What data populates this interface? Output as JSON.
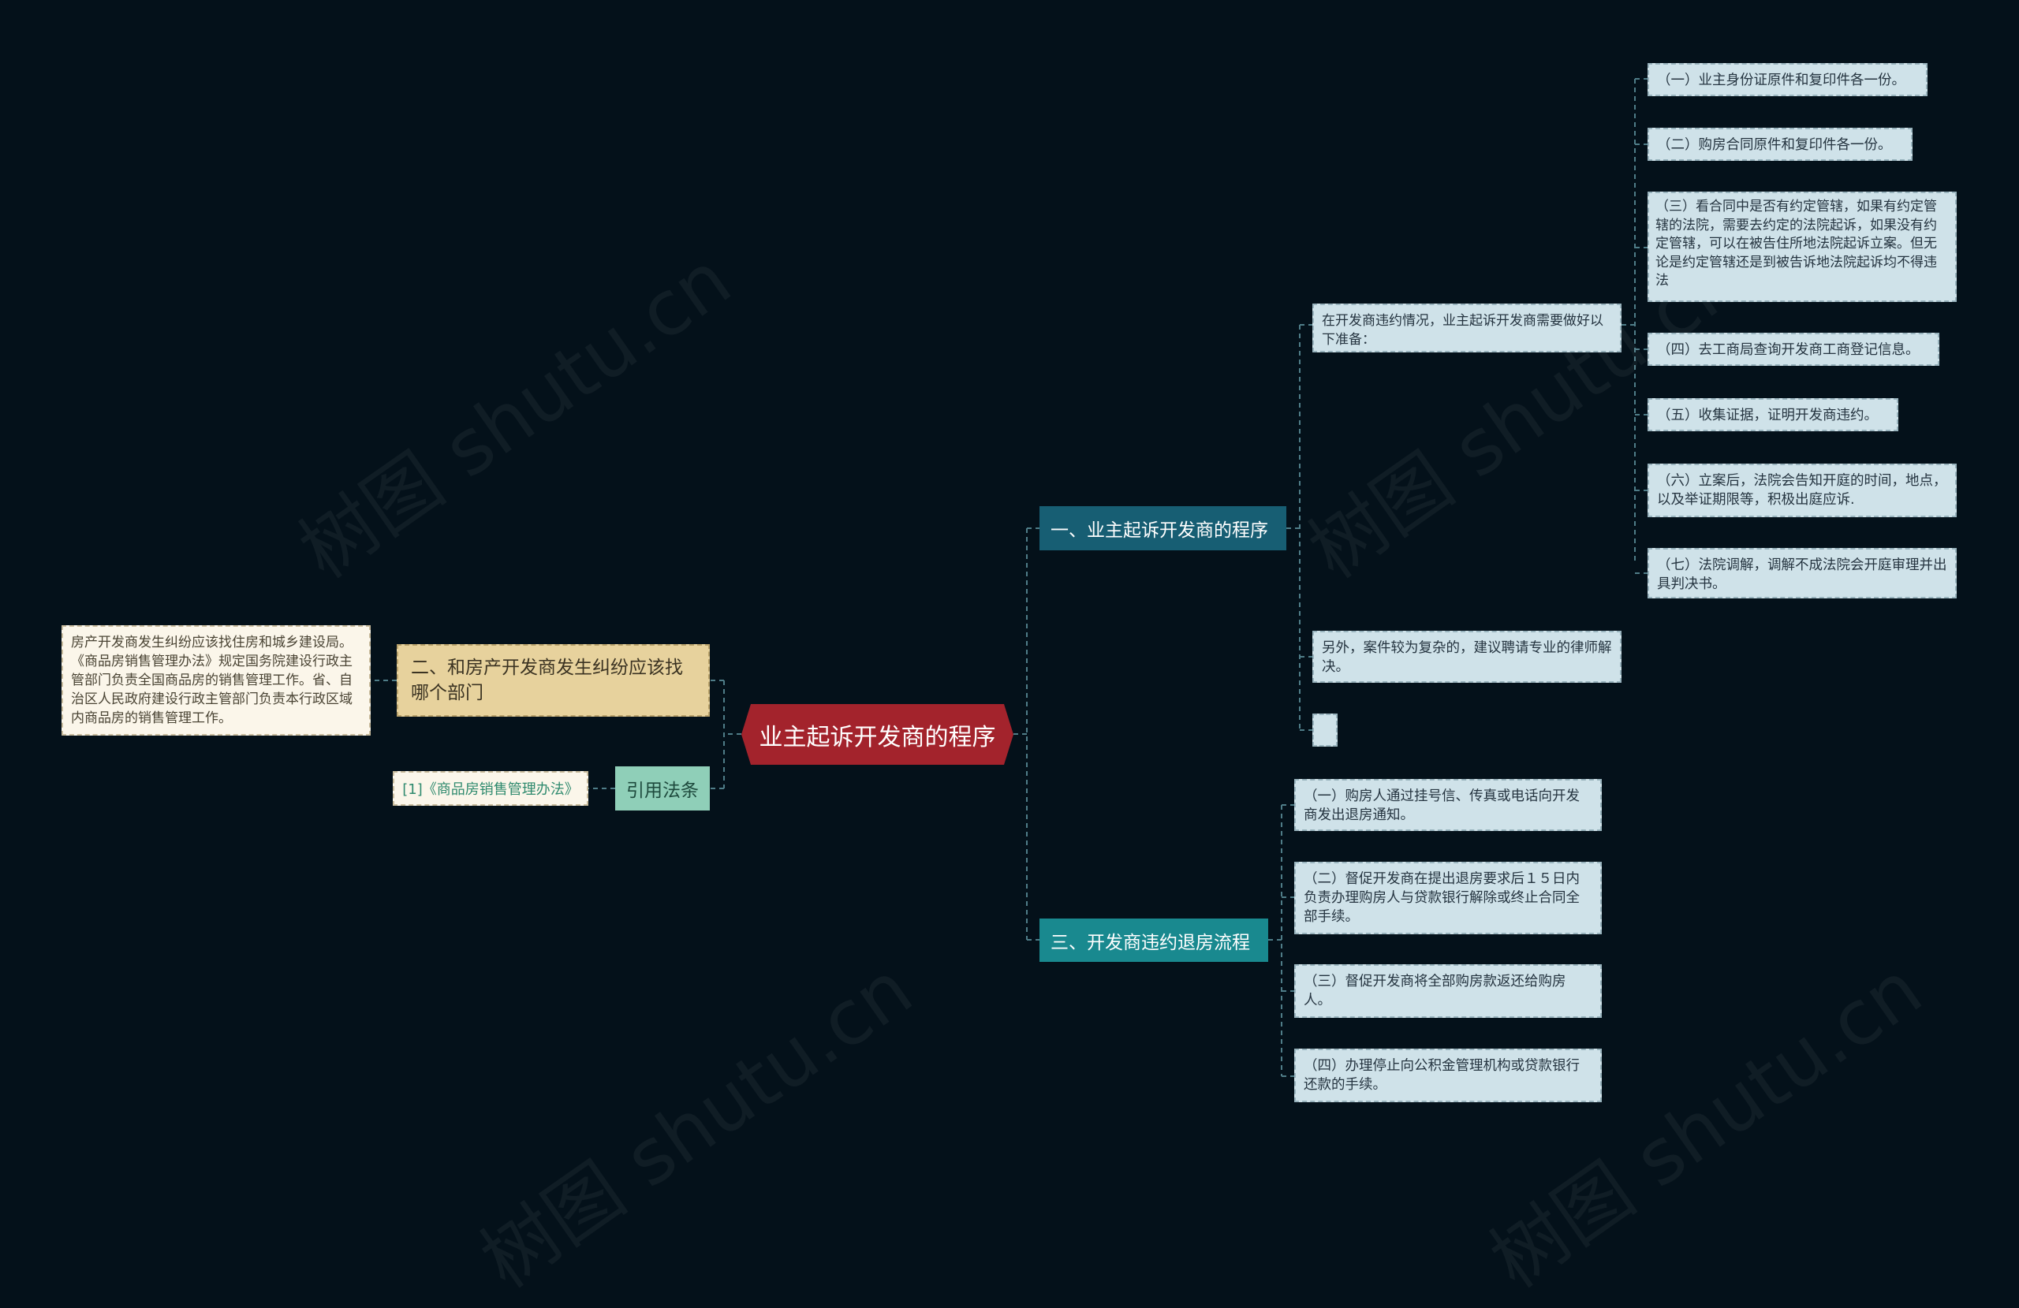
{
  "center": {
    "title": "业主起诉开发商的程序"
  },
  "branch1": {
    "label": "一、业主起诉开发商的程序",
    "group_label": "在开发商违约情况，业主起诉开发商需要做好以下准备：",
    "items": [
      "（一）业主身份证原件和复印件各一份。",
      "（二）购房合同原件和复印件各一份。",
      "（三）看合同中是否有约定管辖，如果有约定管辖的法院，需要去约定的法院起诉，如果没有约定管辖，可以在被告住所地法院起诉立案。但无论是约定管辖还是到被告诉地法院起诉均不得违法",
      "（四）去工商局查询开发商工商登记信息。",
      "（五）收集证据，证明开发商违约。",
      "（六）立案后，法院会告知开庭的时间，地点，以及举证期限等，积极出庭应诉.",
      "（七）法院调解，调解不成法院会开庭审理并出具判决书。"
    ],
    "note": "另外，案件较为复杂的，建议聘请专业的律师解决。",
    "empty": ""
  },
  "branch2": {
    "label": "二、和房产开发商发生纠纷应该找哪个部门",
    "detail": "房产开发商发生纠纷应该找住房和城乡建设局。《商品房销售管理办法》规定国务院建设行政主管部门负责全国商品房的销售管理工作。省、自治区人民政府建设行政主管部门负责本行政区域内商品房的销售管理工作。"
  },
  "citation": {
    "label": "引用法条",
    "item": "[1]《商品房销售管理办法》"
  },
  "branch3": {
    "label": "三、开发商违约退房流程",
    "items": [
      "（一）购房人通过挂号信、传真或电话向开发商发出退房通知。",
      "（二）督促开发商在提出退房要求后１５日内负责办理购房人与贷款银行解除或终止合同全部手续。",
      "（三）督促开发商将全部购房款返还给购房人。",
      "（四）办理停止向公积金管理机构或贷款银行还款的手续。"
    ]
  },
  "watermark": "树图 shutu.cn",
  "colors": {
    "background": "#04111a",
    "center": "#a3232c",
    "branch1": "#175e73",
    "branch3": "#19898f",
    "branch2": "#e7d29d",
    "citation": "#8fcfb8",
    "leaf": "#cfe2e9",
    "connector": "#4f7d88"
  }
}
